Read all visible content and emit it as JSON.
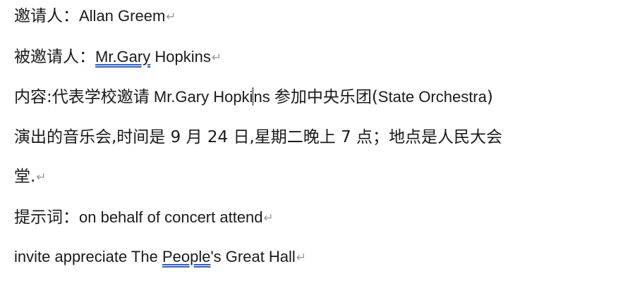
{
  "paragraph_mark": "↵",
  "line1": {
    "label": "邀请人：",
    "name": "Allan Greem"
  },
  "line2": {
    "label": "被邀请人：",
    "name_part1": "Mr.Gary",
    "name_part2": " Hopkins"
  },
  "line3": {
    "label": "内容:代表学校邀请",
    "name_part1": " Mr.Gary Hopki",
    "name_part2": "ns ",
    "cn_text": "参加中央乐团(",
    "orchestra": "State Orchestra",
    "close_paren": ")"
  },
  "line4": {
    "text": "演出的音乐会,时间是 9 月 24 日,星期二晚上 7 点；地点是人民大会"
  },
  "line5": {
    "text": "堂."
  },
  "line6": {
    "label": "提示词：",
    "words": "on behalf of concert attend"
  },
  "line7": {
    "part1": "invite appreciate The ",
    "people": "People",
    "part2": "'s Great Hall"
  }
}
